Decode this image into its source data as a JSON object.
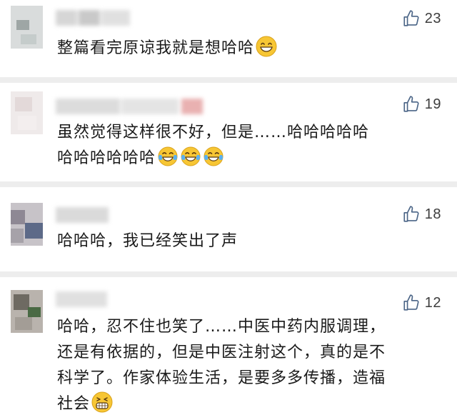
{
  "comments": [
    {
      "likes": "23",
      "lines": [
        "整篇看完原谅我就是想哈哈"
      ],
      "emoji": [
        "grin-emoji"
      ]
    },
    {
      "likes": "19",
      "lines": [
        "虽然觉得这样很不好，但是……哈哈哈哈哈",
        "哈哈哈哈哈哈"
      ],
      "emoji": [
        "tears-of-joy-emoji",
        "tears-of-joy-emoji",
        "tears-of-joy-emoji"
      ]
    },
    {
      "likes": "18",
      "lines": [
        "哈哈哈，我已经笑出了声"
      ],
      "emoji": []
    },
    {
      "likes": "12",
      "lines": [
        "哈哈，忍不住也笑了……中医中药内服调理，",
        "还是有依据的，但是中医注射这个，真的是不",
        "科学了。作家体验生活，是要多多传播，造福",
        "社会"
      ],
      "emoji": [
        "grinning-teeth-emoji"
      ]
    }
  ],
  "icons": {
    "like": "thumbs-up-icon"
  },
  "colors": {
    "like_icon": "#4a6486",
    "separator": "#ededed",
    "text": "#1a1a1a"
  }
}
